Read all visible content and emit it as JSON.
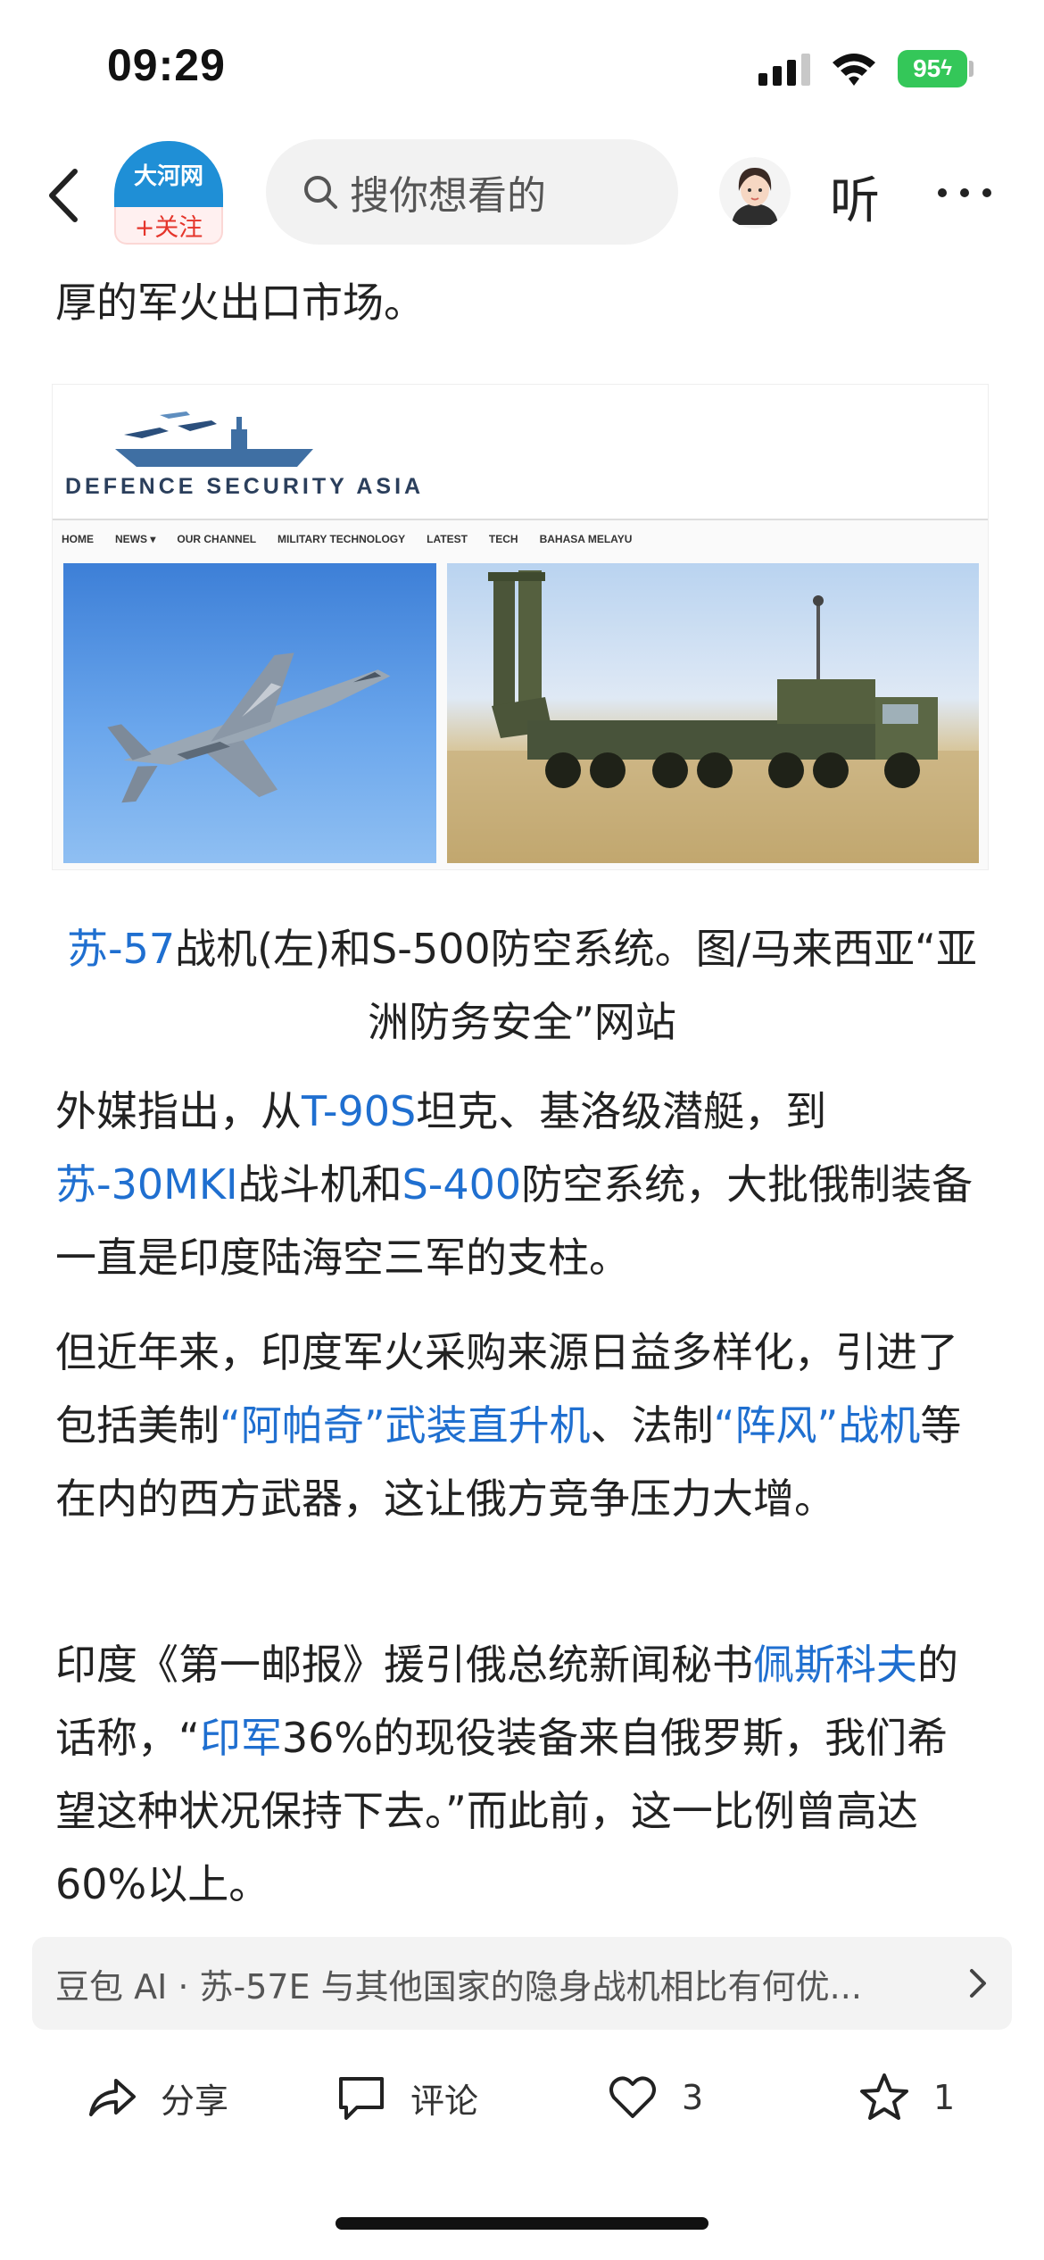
{
  "status_bar": {
    "time": "09:29",
    "battery": "95",
    "icons": [
      "signal-icon",
      "wifi-icon",
      "battery-icon"
    ]
  },
  "nav": {
    "logo_name": "大河网",
    "follow_label": "+关注",
    "search_placeholder": "搜你想看的",
    "listen_label": "听",
    "icons": [
      "back-icon",
      "search-icon",
      "more-icon"
    ]
  },
  "article": {
    "intro_tail": "厚的军火出口市场。",
    "image": {
      "site_name": "DEFENCE SECURITY ASIA",
      "menu": [
        "HOME",
        "NEWS ▾",
        "OUR CHANNEL",
        "MILITARY TECHNOLOGY",
        "LATEST",
        "TECH",
        "BAHASA MELAYU"
      ]
    },
    "caption": {
      "link": "苏-57",
      "rest": "战机(左)和S-500防空系统。图/马来西亚“亚洲防务安全”网站"
    },
    "para1": {
      "t1": "外媒指出，从",
      "l1": "T-90S",
      "t2": "坦克、基洛级潜艇，到",
      "l2": "苏-30MKI",
      "t3": "战斗机和",
      "l3": "S-400",
      "t4": "防空系统，大批俄制装备一直是印度陆海空三军的支柱。"
    },
    "para2": {
      "t1": "但近年来，印度军火采购来源日益多样化，引进了包括美制",
      "l1": "“阿帕奇”武装直升机",
      "t2": "、法制",
      "l2": "“阵风”战机",
      "t3": "等在内的西方武器，这让俄方竞争压力大增。"
    },
    "para3": {
      "t1": "印度《第一邮报》援引俄总统新闻秘书",
      "l1": "佩斯科夫",
      "t2": "的话称，“",
      "l2": "印军",
      "t3": "36%的现役装备来自俄罗斯，我们希望这种状况保持下去。”而此前，这一比例曾高达60%以上。"
    }
  },
  "ai_bar": {
    "text": "豆包 AI · 苏-57E 与其他国家的隐身战机相比有何优..."
  },
  "actions": {
    "share": "分享",
    "comment": "评论",
    "like_count": "3",
    "favorite_count": "1"
  },
  "colors": {
    "link": "#1f6fd0",
    "battery": "#34c759",
    "logo_blue": "#1f8fd6",
    "follow_red": "#e5352b"
  }
}
